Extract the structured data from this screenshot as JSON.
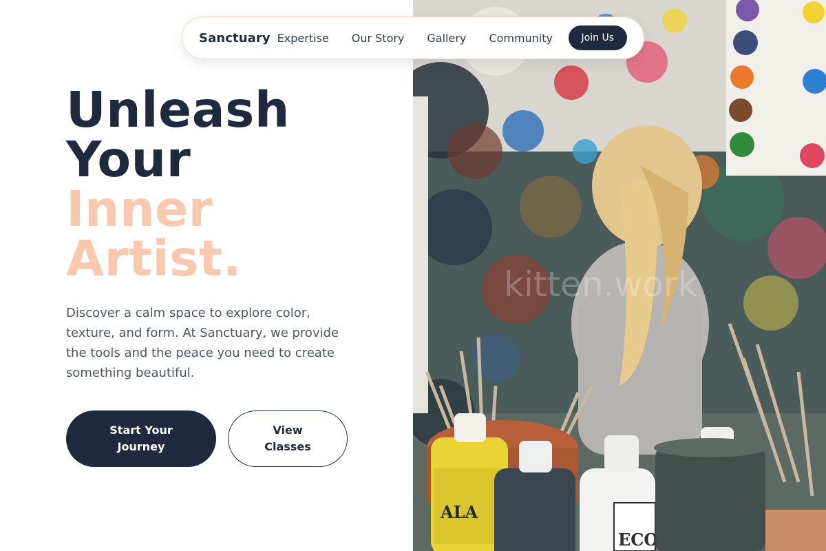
{
  "nav": {
    "brand": "Sanctuary",
    "links": [
      "Expertise",
      "Our Story",
      "Gallery",
      "Community"
    ],
    "cta_label": "Join Us"
  },
  "hero": {
    "headline_line1": "Unleash",
    "headline_line2": "Your",
    "headline_line3": "Inner",
    "headline_line4": "Artist.",
    "description": "Discover a calm space to explore color, texture, and form. At Sanctuary, we provide the tools and the peace you need to create something beautiful.",
    "primary_cta": "Start Your Journey",
    "secondary_cta": "View Classes"
  },
  "image": {
    "watermark": "kitten.work",
    "bottle_label_1": "ALA",
    "bottle_label_2": "ECO",
    "bottle_label_3": "EC"
  },
  "colors": {
    "navy": "#1f2a3f",
    "accent_peach": "#f9c8ad",
    "body_text": "#4b5563"
  }
}
